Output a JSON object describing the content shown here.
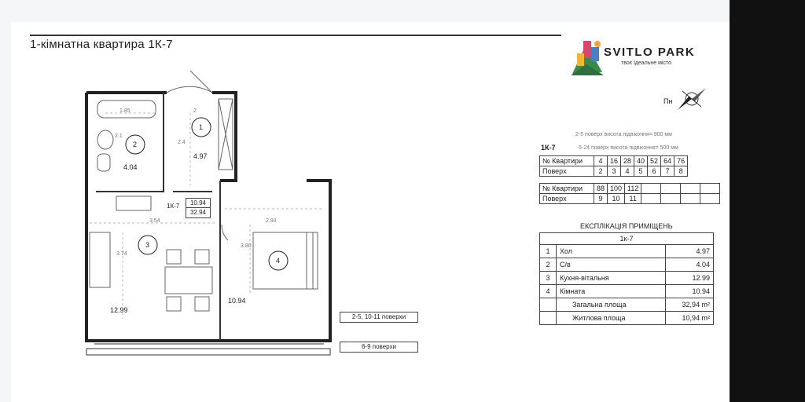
{
  "title": "1-кімнатна квартира 1К-7",
  "brand": {
    "name": "SVITLO PARK",
    "tagline": "твоє ідеальне місто"
  },
  "compass": {
    "label": "Пн"
  },
  "unit_code": "1К-7",
  "notes": {
    "sill_1": "2-5 поверх висота підвіконня= 900 мм",
    "sill_2": "6-24 поверх висота підвіконня= 500 мм"
  },
  "apartments_table": {
    "row_labels": [
      "№ Квартири",
      "Поверх",
      "№ Квартири",
      "Поверх"
    ],
    "apt_1": [
      "4",
      "16",
      "28",
      "40",
      "52",
      "64",
      "76"
    ],
    "floor_1": [
      "2",
      "3",
      "4",
      "5",
      "6",
      "7",
      "8"
    ],
    "apt_2": [
      "88",
      "100",
      "112",
      "",
      "",
      "",
      ""
    ],
    "floor_2": [
      "9",
      "10",
      "11",
      "",
      "",
      "",
      ""
    ]
  },
  "explication": {
    "title": "ЕКСПЛІКАЦІЯ ПРИМІЩЕНЬ",
    "unit": "1к-7",
    "rooms": [
      {
        "num": "1",
        "name": "Хол",
        "area": "4.97"
      },
      {
        "num": "2",
        "name": "С/в",
        "area": "4.04"
      },
      {
        "num": "3",
        "name": "Кухня-вітальня",
        "area": "12.99"
      },
      {
        "num": "4",
        "name": "Кімната",
        "area": "10.94"
      }
    ],
    "total_label": "Загальна площа",
    "total_value": "32,94 m²",
    "living_label": "Житлова площа",
    "living_value": "10,94 m²"
  },
  "plan": {
    "room_numbers": [
      "1",
      "2",
      "3",
      "4"
    ],
    "room_areas": [
      "4.97",
      "4.04",
      "12.99",
      "10.94"
    ],
    "dims": {
      "bath": "1.85",
      "hall_w": "2",
      "bath_h": "2.1",
      "hall_h": "2.4",
      "kitchen_w": "3.54",
      "kitchen_h": "3.74",
      "room_w": "2.93",
      "room_h": "3.80"
    },
    "unit_tag": {
      "code": "1К-7",
      "living": "10.94",
      "total": "32.94"
    }
  },
  "floor_labels": {
    "a": "2-5, 10-11 поверхи",
    "b": "6-9 поверхи"
  }
}
